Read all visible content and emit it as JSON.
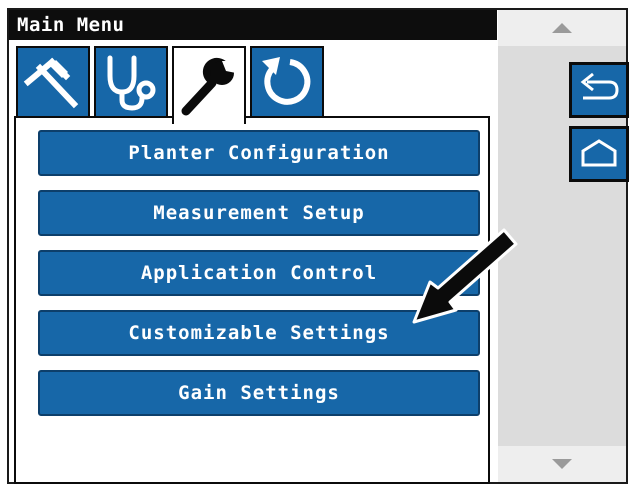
{
  "window": {
    "title": "Main Menu"
  },
  "tabs": [
    {
      "icon": "tools-icon",
      "active": false
    },
    {
      "icon": "diagnostics-stethoscope-icon",
      "active": false
    },
    {
      "icon": "wrench-icon",
      "active": true
    },
    {
      "icon": "reset-icon",
      "active": false
    }
  ],
  "menu": {
    "items": [
      {
        "label": "Planter Configuration"
      },
      {
        "label": "Measurement Setup"
      },
      {
        "label": "Application Control"
      },
      {
        "label": "Customizable Settings"
      },
      {
        "label": "Gain Settings"
      }
    ]
  },
  "side_buttons": [
    {
      "icon": "back-arrow-icon"
    },
    {
      "icon": "home-icon"
    }
  ],
  "colors": {
    "button_blue": "#1767a8",
    "title_bar": "#0d0d0d",
    "scroll_area": "#dcdcdc"
  }
}
